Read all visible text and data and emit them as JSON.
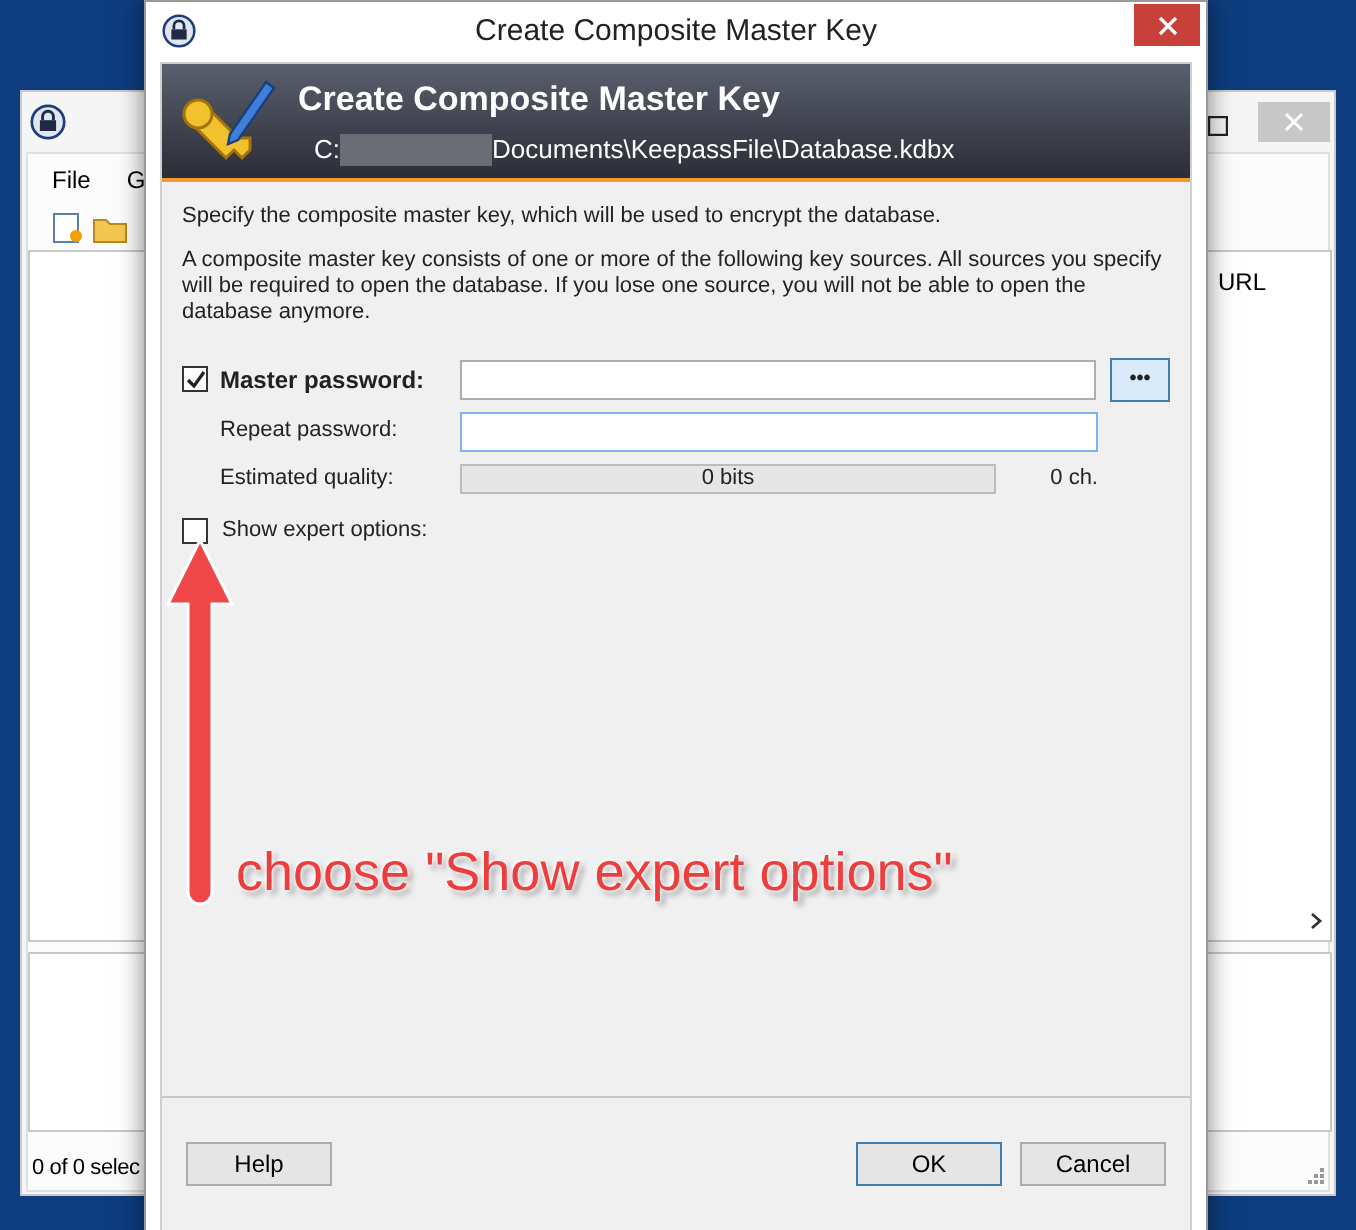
{
  "background_window": {
    "menu": [
      "File",
      "G"
    ],
    "list": {
      "columns": [
        "URL"
      ]
    },
    "status_bar": "0 of 0 selec"
  },
  "dialog": {
    "title": "Create Composite Master Key",
    "banner": {
      "title": "Create Composite Master Key",
      "path_start": "C:",
      "path_end": "Documents\\KeepassFile\\Database.kdbx"
    },
    "intro": "Specify the composite master key, which will be used to encrypt the database.",
    "description": "A composite master key consists of one or more of the following key sources. All sources you specify will be required to open the database. If you lose one source, you will not be able to open the database anymore.",
    "master_password": {
      "label": "Master password:",
      "checked": true,
      "reveal_button": "•••"
    },
    "repeat_password": {
      "label": "Repeat password:"
    },
    "quality": {
      "label": "Estimated quality:",
      "reading": "0 bits",
      "level": 0,
      "count": "0 ch."
    },
    "expert_options": {
      "label": "Show expert options:",
      "checked": false
    },
    "buttons": [
      {
        "label": "Help",
        "default": false
      },
      {
        "label": "OK",
        "default": true
      },
      {
        "label": "Cancel",
        "default": false
      }
    ]
  },
  "annotation": {
    "text": "choose \"Show expert options\""
  }
}
